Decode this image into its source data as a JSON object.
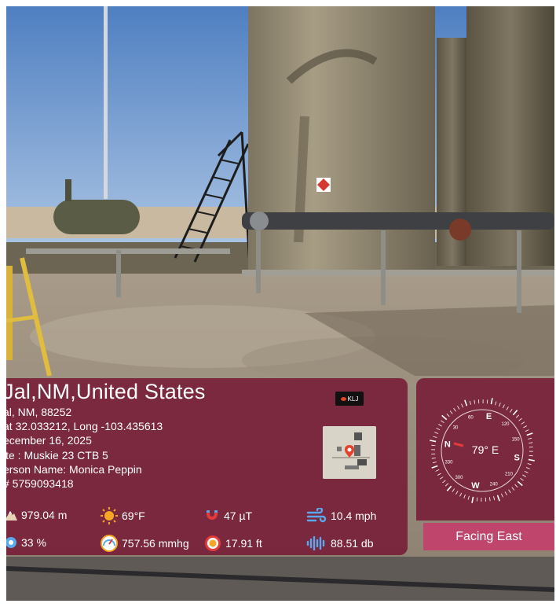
{
  "location": {
    "title": "Jal,NM,United States",
    "address": "al, NM, 88252",
    "coordinates": "at 32.033212, Long -103.435613",
    "date": "ecember 16, 2025",
    "site": "ite : Muskie 23 CTB 5",
    "person": "erson Name: Monica Peppin",
    "phone": "# 5759093418"
  },
  "brand": {
    "logo_text": "KLJ"
  },
  "sensors": {
    "altitude": {
      "icon": "mountain-icon",
      "value": "979.04 m"
    },
    "temperature": {
      "icon": "sun-icon",
      "value": "69°F"
    },
    "magnetic": {
      "icon": "magnet-icon",
      "value": "47 µT"
    },
    "wind": {
      "icon": "wind-icon",
      "value": "10.4 mph"
    },
    "humidity": {
      "icon": "humidity-icon",
      "value": "33 %"
    },
    "pressure": {
      "icon": "gauge-icon",
      "value": "757.56 mmhg"
    },
    "accuracy": {
      "icon": "target-icon",
      "value": "17.91 ft"
    },
    "sound": {
      "icon": "sound-wave-icon",
      "value": "88.51 db"
    }
  },
  "compass": {
    "heading": "79° E",
    "facing": "Facing East",
    "cardinals": [
      "N",
      "E",
      "S",
      "W"
    ],
    "degree_labels": [
      "30",
      "60",
      "120",
      "150",
      "210",
      "240",
      "300",
      "330"
    ],
    "needle_color": "#e23b3b"
  },
  "colors": {
    "panel": "#761834",
    "facing_bar": "#c0456d"
  }
}
